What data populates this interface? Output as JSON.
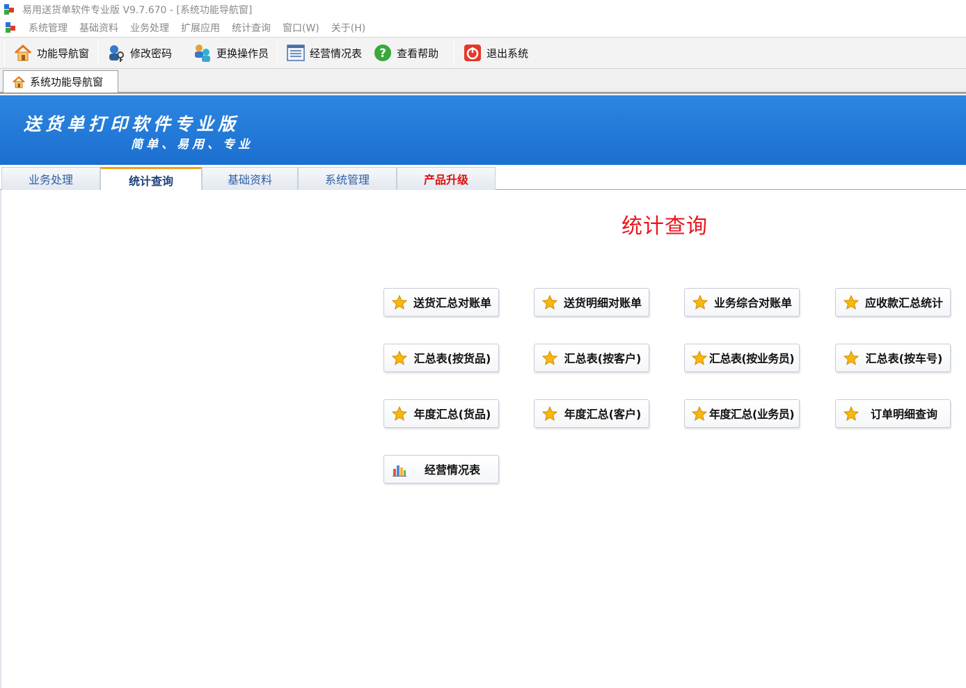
{
  "window": {
    "title": "易用送货单软件专业版 V9.7.670 - [系统功能导航窗]"
  },
  "menubar": {
    "items": [
      "系统管理",
      "基础资料",
      "业务处理",
      "扩展应用",
      "统计查询",
      "窗口(W)",
      "关于(H)"
    ]
  },
  "toolbar": {
    "buttons": [
      {
        "label": "功能导航窗",
        "icon": "home-icon"
      },
      {
        "label": "修改密码",
        "icon": "key-user-icon"
      },
      {
        "label": "更换操作员",
        "icon": "users-switch-icon"
      },
      {
        "label": "经营情况表",
        "icon": "report-list-icon"
      },
      {
        "label": "查看帮助",
        "icon": "help-icon"
      },
      {
        "label": "退出系统",
        "icon": "power-icon"
      }
    ]
  },
  "doc_tab": {
    "label": "系统功能导航窗",
    "icon": "home-icon"
  },
  "banner": {
    "title": "送货单打印软件专业版",
    "subtitle": "简单、易用、专业"
  },
  "module_tabs": {
    "items": [
      "业务处理",
      "统计查询",
      "基础资料",
      "系统管理",
      "产品升级"
    ],
    "active": "统计查询",
    "highlight": "产品升级"
  },
  "section": {
    "title": "统计查询"
  },
  "functions": [
    {
      "label": "送货汇总对账单",
      "icon": "star-icon"
    },
    {
      "label": "送货明细对账单",
      "icon": "star-icon"
    },
    {
      "label": "业务综合对账单",
      "icon": "star-icon"
    },
    {
      "label": "应收款汇总统计",
      "icon": "star-icon"
    },
    {
      "label": "汇总表(按货品)",
      "icon": "star-icon"
    },
    {
      "label": "汇总表(按客户)",
      "icon": "star-icon"
    },
    {
      "label": "汇总表(按业务员)",
      "icon": "star-icon"
    },
    {
      "label": "汇总表(按车号)",
      "icon": "star-icon"
    },
    {
      "label": "年度汇总(货品)",
      "icon": "star-icon"
    },
    {
      "label": "年度汇总(客户)",
      "icon": "star-icon"
    },
    {
      "label": "年度汇总(业务员)",
      "icon": "star-icon"
    },
    {
      "label": "订单明细查询",
      "icon": "star-icon"
    },
    {
      "label": "经营情况表",
      "icon": "bar-chart-icon"
    }
  ],
  "colors": {
    "banner": "#1f74d6",
    "section_title": "#e8161c",
    "upgrade_tab": "#e01010",
    "active_tab_marker": "#f0a020"
  }
}
